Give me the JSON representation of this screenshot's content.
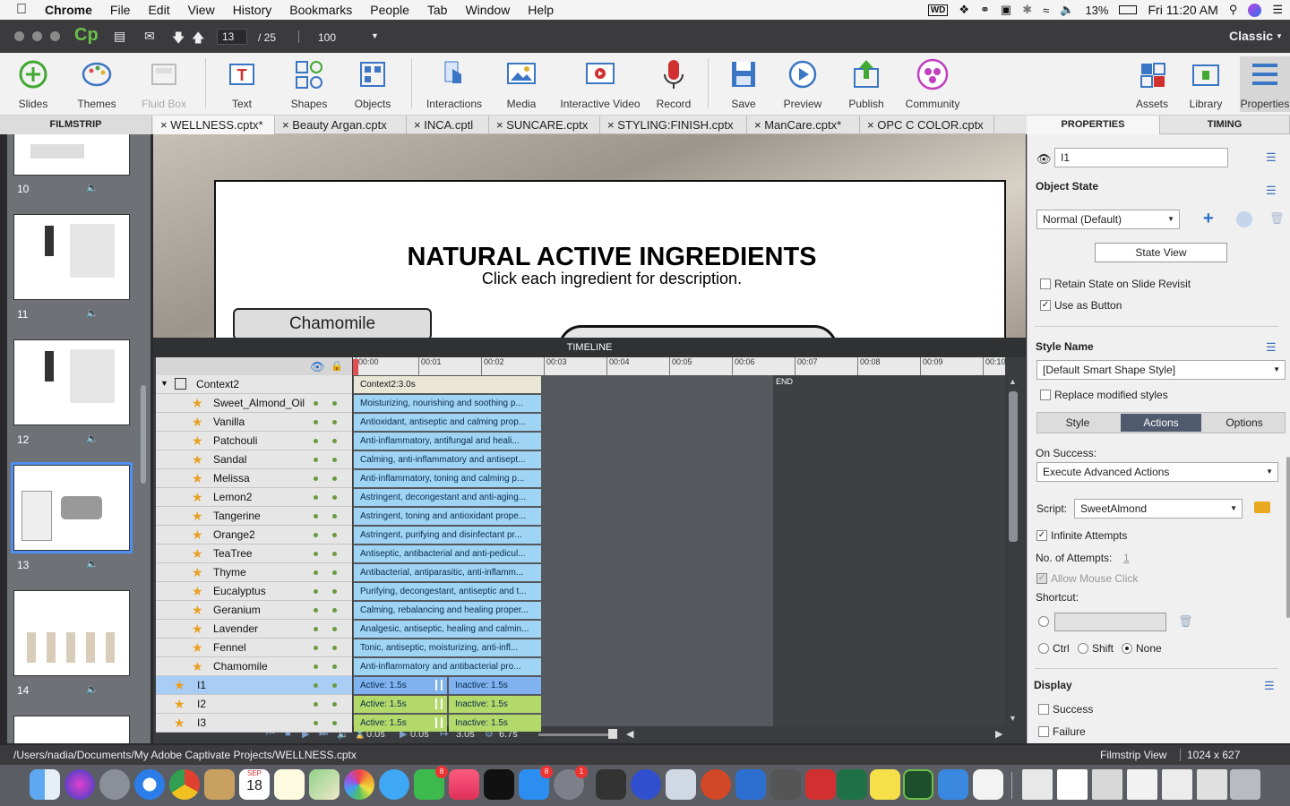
{
  "menubar": {
    "app": "Chrome",
    "items": [
      "File",
      "Edit",
      "View",
      "History",
      "Bookmarks",
      "People",
      "Tab",
      "Window",
      "Help"
    ],
    "battery": "13%",
    "clock": "Fri 11:20 AM"
  },
  "topbar": {
    "logo": "Cp",
    "slide_current": "13",
    "slide_total": "/ 25",
    "zoom": "100",
    "mode": "Classic"
  },
  "toolbar": {
    "slides": "Slides",
    "themes": "Themes",
    "fluid_box": "Fluid Box",
    "text": "Text",
    "shapes": "Shapes",
    "objects": "Objects",
    "interactions": "Interactions",
    "media": "Media",
    "interactive_video": "Interactive Video",
    "record": "Record",
    "save": "Save",
    "preview": "Preview",
    "publish": "Publish",
    "community": "Community",
    "assets": "Assets",
    "library": "Library",
    "properties": "Properties"
  },
  "filmstrip": {
    "title": "FILMSTRIP",
    "slides": [
      "10",
      "11",
      "12",
      "13",
      "14"
    ]
  },
  "tabs": [
    "WELLNESS.cptx*",
    "Beauty Argan.cptx",
    "INCA.cptl",
    "SUNCARE.cptx",
    "STYLING:FINISH.cptx",
    "ManCare.cptx*",
    "OPC C COLOR.cptx"
  ],
  "slide": {
    "title": "NATURAL ACTIVE INGREDIENTS",
    "subtitle": "Click each ingredient for description.",
    "button": "Chamomile"
  },
  "timeline": {
    "title": "TIMELINE",
    "ticks": [
      "00:00",
      "00:01",
      "00:02",
      "00:03",
      "00:04",
      "00:05",
      "00:06",
      "00:07",
      "00:08",
      "00:09",
      "00:10"
    ],
    "end_label": "END",
    "group": {
      "name": "Context2",
      "bar": "Context2:3.0s"
    },
    "rows": [
      {
        "name": "Sweet_Almond_Oil",
        "bar": "Moisturizing, nourishing and soothing p..."
      },
      {
        "name": "Vanilla",
        "bar": "Antioxidant, antiseptic and calming prop..."
      },
      {
        "name": "Patchouli",
        "bar": "Anti-inflammatory, antifungal and heali..."
      },
      {
        "name": "Sandal",
        "bar": "Calming, anti-inflammatory and antisept..."
      },
      {
        "name": "Melissa",
        "bar": "Anti-inflammatory, toning and calming p..."
      },
      {
        "name": "Lemon2",
        "bar": "Astringent, decongestant and anti-aging..."
      },
      {
        "name": "Tangerine",
        "bar": "Astringent, toning and antioxidant prope..."
      },
      {
        "name": "Orange2",
        "bar": "Astringent, purifying and disinfectant pr..."
      },
      {
        "name": "TeaTree",
        "bar": "Antiseptic, antibacterial and anti-pedicul..."
      },
      {
        "name": "Thyme",
        "bar": "Antibacterial, antiparasitic, anti-inflamm..."
      },
      {
        "name": "Eucalyptus",
        "bar": "Purifying, decongestant, antiseptic and t..."
      },
      {
        "name": "Geranium",
        "bar": "Calming, rebalancing and healing proper..."
      },
      {
        "name": "Lavender",
        "bar": "Analgesic, antiseptic, healing and calmin..."
      },
      {
        "name": "Fennel",
        "bar": "Tonic, antiseptic, moisturizing, anti-infl..."
      },
      {
        "name": "Chamomile",
        "bar": "Anti-inflammatory and antibacterial pro..."
      }
    ],
    "buttons": [
      {
        "name": "I1",
        "active": "Active: 1.5s",
        "inactive": "Inactive: 1.5s"
      },
      {
        "name": "I2",
        "active": "Active: 1.5s",
        "inactive": "Inactive: 1.5s"
      },
      {
        "name": "I3",
        "active": "Active: 1.5s",
        "inactive": "Inactive: 1.5s"
      }
    ],
    "footer": {
      "t1": "0.0s",
      "t2": "0.0s",
      "t3": "3.0s",
      "t4": "6.7s"
    }
  },
  "properties": {
    "tab_props": "PROPERTIES",
    "tab_timing": "TIMING",
    "name_value": "I1",
    "object_state": "Object State",
    "state_value": "Normal (Default)",
    "state_view": "State View",
    "retain_state": "Retain State on Slide Revisit",
    "use_as_button": "Use as Button",
    "style_name": "Style Name",
    "style_value": "[Default Smart Shape Style]",
    "replace_styles": "Replace modified styles",
    "subtabs": [
      "Style",
      "Actions",
      "Options"
    ],
    "on_success": "On Success:",
    "on_success_value": "Execute Advanced Actions",
    "script_label": "Script:",
    "script_value": "SweetAlmond",
    "infinite": "Infinite Attempts",
    "attempts_label": "No. of Attempts:",
    "attempts_value": "1",
    "allow_click": "Allow Mouse Click",
    "shortcut": "Shortcut:",
    "ctrl": "Ctrl",
    "shift": "Shift",
    "none": "None",
    "display": "Display",
    "success": "Success",
    "failure": "Failure"
  },
  "statusbar": {
    "path": "/Users/nadia/Documents/My Adobe Captivate Projects/WELLNESS.cptx",
    "view": "Filmstrip View",
    "size": "1024 x 627"
  },
  "dock": {
    "calendar_month": "SEP",
    "calendar_day": "18",
    "badge_mail": "8",
    "badge_appstore": "8",
    "badge_prefs": "1"
  },
  "colors": {
    "accent": "#3d8ef0",
    "bar_blue": "#9fd4f5",
    "bar_green": "#b3d96a",
    "bar_active": "#7fb2ef"
  }
}
